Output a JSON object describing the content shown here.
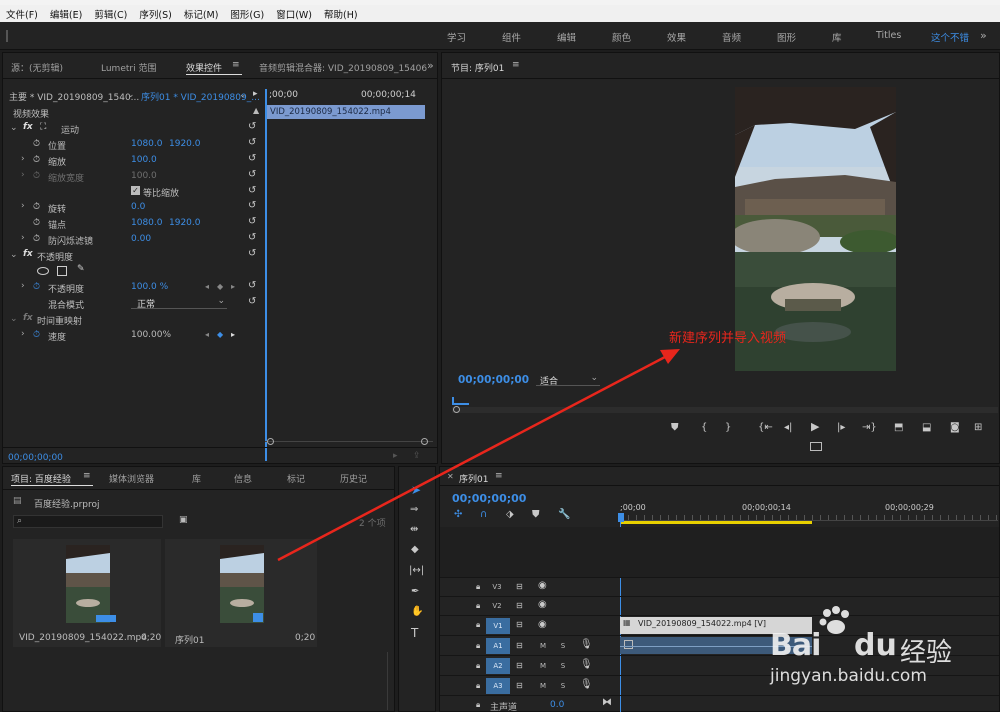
{
  "menu": [
    "文件(F)",
    "编辑(E)",
    "剪辑(C)",
    "序列(S)",
    "标记(M)",
    "图形(G)",
    "窗口(W)",
    "帮助(H)"
  ],
  "workspaces": [
    "学习",
    "组件",
    "编辑",
    "颜色",
    "效果",
    "音频",
    "图形",
    "库",
    "Titles",
    "这个不错"
  ],
  "source_panel": {
    "tabs": [
      "源：(无剪辑)",
      "Lumetri 范围",
      "效果控件",
      "音频剪辑混合器: VID_20190809_15406"
    ],
    "master_label": "主要 * VID_20190809_1540...",
    "sequence_label": "序列01 * VID_20190809_...",
    "time_start": ";00;00",
    "time_end": "00;00;00;14",
    "clip_name": "VID_20190809_154022.mp4",
    "section_video": "视频效果",
    "motion": "运动",
    "position": "位置",
    "position_x": "1080.0",
    "position_y": "1920.0",
    "scale": "缩放",
    "scale_val": "100.0",
    "scale_width": "缩放宽度",
    "scale_width_val": "100.0",
    "uniform_scale": "等比缩放",
    "rotation": "旋转",
    "rotation_val": "0.0",
    "anchor": "锚点",
    "anchor_x": "1080.0",
    "anchor_y": "1920.0",
    "flicker": "防闪烁滤镜",
    "flicker_val": "0.00",
    "opacity_group": "不透明度",
    "opacity": "不透明度",
    "opacity_val": "100.0 %",
    "blend_mode": "混合模式",
    "blend_val": "正常",
    "time_remap": "时间重映射",
    "speed": "速度",
    "speed_val": "100.00%",
    "footer_time": "00;00;00;00"
  },
  "program_panel": {
    "title": "节目: 序列01",
    "timecode": "00;00;00;00",
    "fit": "适合",
    "annotation": "新建序列并导入视频"
  },
  "project_panel": {
    "tabs": [
      "项目: 百度经验",
      "媒体浏览器",
      "库",
      "信息",
      "标记",
      "历史记"
    ],
    "file": "百度经验.prproj",
    "items_count": "2 个项",
    "items": [
      {
        "name": "VID_20190809_154022.mp4",
        "duration": "0;20"
      },
      {
        "name": "序列01",
        "duration": "0;20"
      }
    ]
  },
  "timeline": {
    "title": "序列01",
    "timecode": "00;00;00;00",
    "ruler": [
      ";00;00",
      "00;00;00;14",
      "00;00;00;29"
    ],
    "tracks": [
      "V3",
      "V2",
      "V1",
      "A1",
      "A2",
      "A3"
    ],
    "master": "主声道",
    "master_val": "0.0",
    "clip_label": "VID_20190809_154022.mp4 [V]",
    "mute": "M",
    "solo": "S"
  },
  "watermark": {
    "brand": "Bai",
    "brand2": "du",
    "jy": "经验",
    "url": "jingyan.baidu.com"
  },
  "colors": {
    "accent": "#3d8ee6",
    "arrow": "#e8261c",
    "annotation": "#e8261c"
  }
}
